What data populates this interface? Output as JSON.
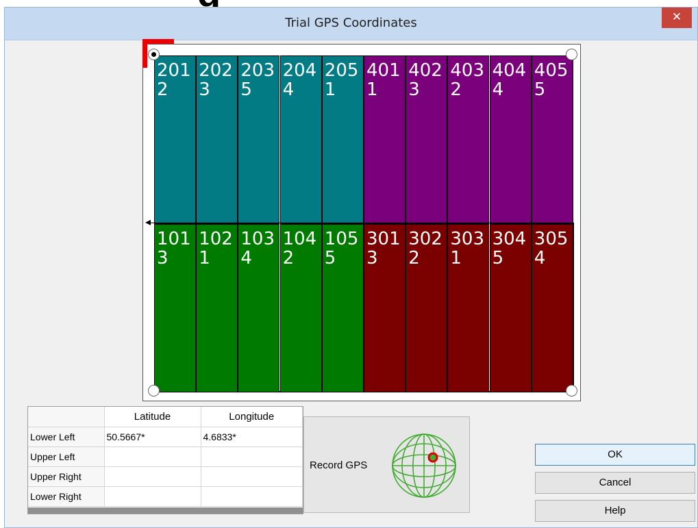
{
  "dialog": {
    "title": "Trial GPS Coordinates",
    "close_glyph": "✕"
  },
  "plots": {
    "colors": {
      "block_200": "#027B84",
      "block_400": "#7B007B",
      "block_100": "#007B00",
      "block_300": "#7B0000"
    },
    "top_row": [
      {
        "plot": "201",
        "treatment": "2",
        "color": "#027B84"
      },
      {
        "plot": "202",
        "treatment": "3",
        "color": "#027B84"
      },
      {
        "plot": "203",
        "treatment": "5",
        "color": "#027B84"
      },
      {
        "plot": "204",
        "treatment": "4",
        "color": "#027B84"
      },
      {
        "plot": "205",
        "treatment": "1",
        "color": "#027B84"
      },
      {
        "plot": "401",
        "treatment": "1",
        "color": "#7B007B"
      },
      {
        "plot": "402",
        "treatment": "3",
        "color": "#7B007B"
      },
      {
        "plot": "403",
        "treatment": "2",
        "color": "#7B007B"
      },
      {
        "plot": "404",
        "treatment": "4",
        "color": "#7B007B"
      },
      {
        "plot": "405",
        "treatment": "5",
        "color": "#7B007B"
      }
    ],
    "bottom_row": [
      {
        "plot": "101",
        "treatment": "3",
        "color": "#007B00"
      },
      {
        "plot": "102",
        "treatment": "1",
        "color": "#007B00"
      },
      {
        "plot": "103",
        "treatment": "4",
        "color": "#007B00"
      },
      {
        "plot": "104",
        "treatment": "2",
        "color": "#007B00"
      },
      {
        "plot": "105",
        "treatment": "5",
        "color": "#007B00"
      },
      {
        "plot": "301",
        "treatment": "3",
        "color": "#7B0000"
      },
      {
        "plot": "302",
        "treatment": "2",
        "color": "#7B0000"
      },
      {
        "plot": "303",
        "treatment": "1",
        "color": "#7B0000"
      },
      {
        "plot": "304",
        "treatment": "5",
        "color": "#7B0000"
      },
      {
        "plot": "305",
        "treatment": "4",
        "color": "#7B0000"
      }
    ]
  },
  "coordinates": {
    "headers": [
      "",
      "Latitude",
      "Longitude"
    ],
    "rows": [
      {
        "corner": "Lower Left",
        "latitude": "50.5667*",
        "longitude": "4.6833*"
      },
      {
        "corner": "Upper Left",
        "latitude": "",
        "longitude": ""
      },
      {
        "corner": "Upper Right",
        "latitude": "",
        "longitude": ""
      },
      {
        "corner": "Lower Right",
        "latitude": "",
        "longitude": ""
      }
    ]
  },
  "record_gps": {
    "label": "Record GPS",
    "icon": "globe-icon"
  },
  "buttons": {
    "ok": "OK",
    "cancel": "Cancel",
    "help": "Help"
  },
  "accent_colors": {
    "corner_marker": "#EE0000",
    "close_button": "#C7443A",
    "globe": "#44AA33"
  }
}
